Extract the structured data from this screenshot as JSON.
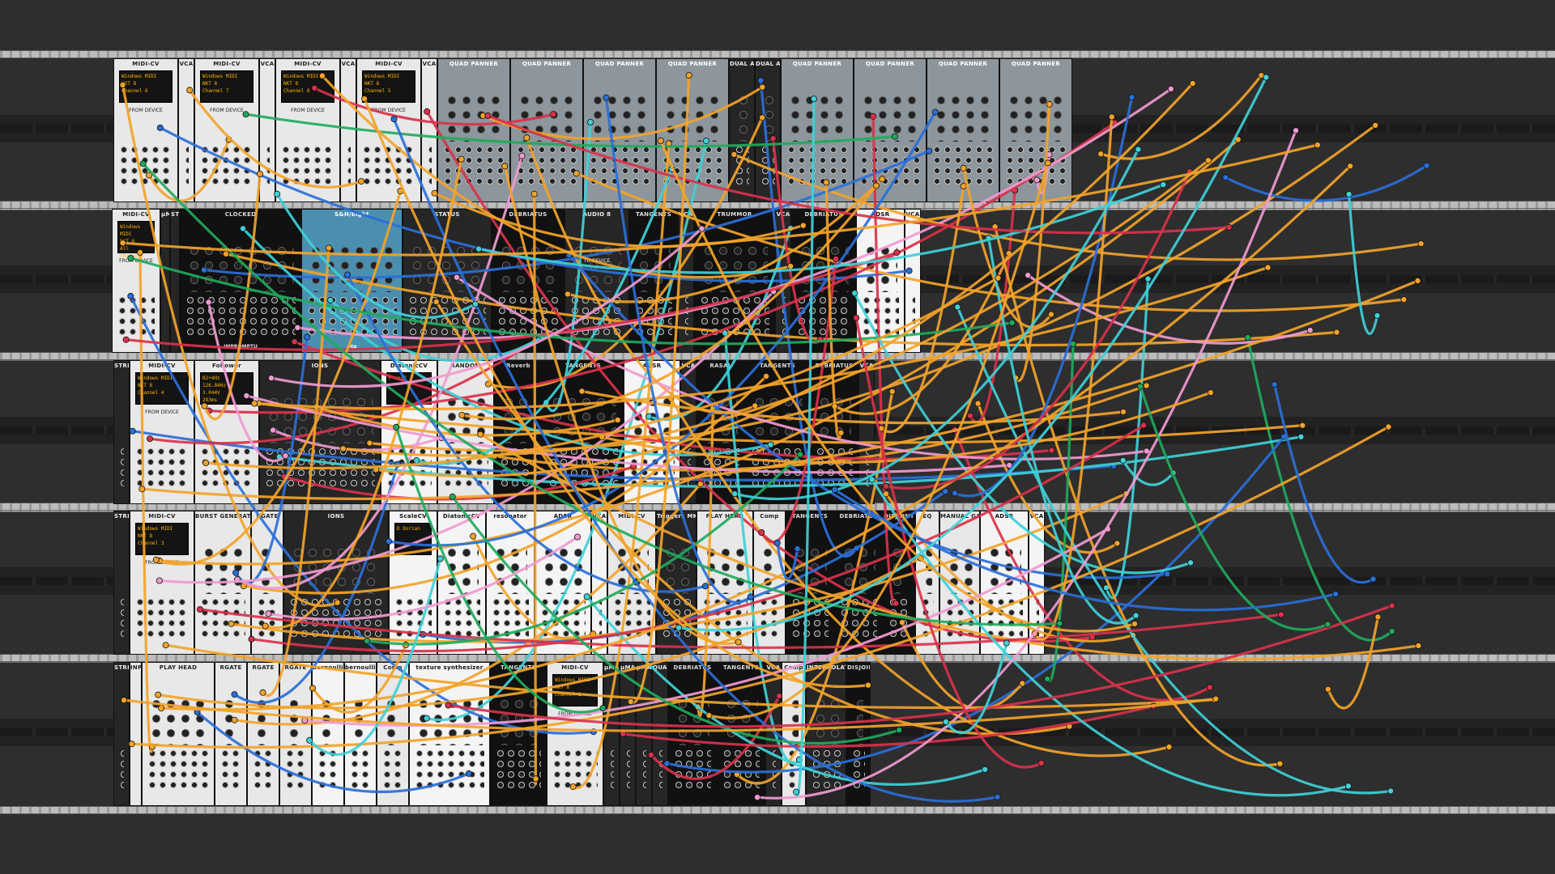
{
  "app": {
    "name": "VCV Rack patch"
  },
  "colors": {
    "orange": "#f2a32a",
    "red": "#d8324a",
    "green": "#1faa5c",
    "cyan": "#3fd0d8",
    "pink": "#f09ad0",
    "blue": "#2a6fd8"
  },
  "rows": [
    {
      "index": 0,
      "modules": [
        {
          "label": "MIDI-CV",
          "name": "midi-cv-r1a",
          "kind": "light",
          "midi": [
            "Windows MIDI",
            "NKT 8",
            "Channel 6"
          ],
          "sub": "FROM DEVICE"
        },
        {
          "label": "VCA",
          "name": "vca-r1a",
          "kind": "light"
        },
        {
          "label": "MIDI-CV",
          "name": "midi-cv-r1b",
          "kind": "light",
          "midi": [
            "Windows MIDI",
            "NKT 8",
            "Channel 7"
          ],
          "sub": "FROM DEVICE"
        },
        {
          "label": "VCA",
          "name": "vca-r1b",
          "kind": "light"
        },
        {
          "label": "MIDI-CV",
          "name": "midi-cv-r1c",
          "kind": "light",
          "midi": [
            "Windows MIDI",
            "NKT 8",
            "Channel 8"
          ],
          "sub": "FROM DEVICE"
        },
        {
          "label": "VCA",
          "name": "vca-r1c",
          "kind": "light"
        },
        {
          "label": "MIDI-CV",
          "name": "midi-cv-r1d",
          "kind": "light",
          "midi": [
            "Windows MIDI",
            "NKT 8",
            "Channel 5"
          ],
          "sub": "FROM DEVICE"
        },
        {
          "label": "VCA",
          "name": "vca-r1d",
          "kind": "light"
        },
        {
          "label": "QUAD PANNER",
          "name": "quad-panner-1",
          "kind": "grey"
        },
        {
          "label": "QUAD PANNER",
          "name": "quad-panner-2",
          "kind": "grey"
        },
        {
          "label": "QUAD PANNER",
          "name": "quad-panner-3",
          "kind": "grey"
        },
        {
          "label": "QUAD PANNER",
          "name": "quad-panner-4",
          "kind": "grey"
        },
        {
          "label": "DUAL ATTENUVERTER",
          "name": "dual-attenuverter-1",
          "kind": "dark"
        },
        {
          "label": "DUAL ATTENUVERTER",
          "name": "dual-attenuverter-2",
          "kind": "dark"
        },
        {
          "label": "QUAD PANNER",
          "name": "quad-panner-5",
          "kind": "grey"
        },
        {
          "label": "QUAD PANNER",
          "name": "quad-panner-6",
          "kind": "grey"
        },
        {
          "label": "QUAD PANNER",
          "name": "quad-panner-7",
          "kind": "grey"
        },
        {
          "label": "QUAD PANNER",
          "name": "quad-panner-8",
          "kind": "grey"
        }
      ]
    },
    {
      "index": 1,
      "modules": [
        {
          "label": "MIDI-CV",
          "name": "midi-cv-r2a",
          "kind": "light",
          "midi": [
            "Windows MIDI",
            "NKT 8",
            "All channels"
          ],
          "sub": "FROM DEVICE"
        },
        {
          "label": "μMAP",
          "name": "umap-r2",
          "kind": "dark"
        },
        {
          "label": "STRIP",
          "name": "strip-r2",
          "kind": "dark"
        },
        {
          "label": "CLOCKED",
          "name": "clocked",
          "kind": "black",
          "footer": "IMPROMPTU"
        },
        {
          "label": "S&H/Eight",
          "name": "sh-eight",
          "kind": "blue",
          "footer": "→tp"
        },
        {
          "label": "STATUS",
          "name": "status",
          "kind": "dark"
        },
        {
          "label": "DEBRIATUS",
          "name": "debriatus-r2a",
          "kind": "black"
        },
        {
          "label": "AUDIO 8",
          "name": "audio-8",
          "kind": "dark",
          "sub": "TO DEVICE"
        },
        {
          "label": "TANGENTS",
          "name": "tangents-r2",
          "kind": "black"
        },
        {
          "label": "VCA",
          "name": "vca-r2a",
          "kind": "dark"
        },
        {
          "label": "TRUMMOR",
          "name": "trummor",
          "kind": "black"
        },
        {
          "label": "VCA",
          "name": "vca-r2b",
          "kind": "dark"
        },
        {
          "label": "DEBRIATUS",
          "name": "debriatus-r2b",
          "kind": "black"
        },
        {
          "label": "ADSR",
          "name": "adsr-r2",
          "kind": "white"
        },
        {
          "label": "VCA",
          "name": "vca-r2c",
          "kind": "white"
        }
      ]
    },
    {
      "index": 2,
      "modules": [
        {
          "label": "STRIP",
          "name": "strip-r3",
          "kind": "dark"
        },
        {
          "label": "MIDI-CV",
          "name": "midi-cv-r3",
          "kind": "light",
          "midi": [
            "Windows MIDI",
            "NKT 8",
            "Channel 4"
          ],
          "sub": "FROM DEVICE"
        },
        {
          "label": "Follower",
          "name": "follower",
          "kind": "light",
          "screen": [
            "B2+4Hz",
            "126.84Hz",
            "3.044V",
            "283ms"
          ]
        },
        {
          "label": "IONS",
          "name": "ions-r3",
          "kind": "dark"
        },
        {
          "label": "DiatonicCV",
          "name": "diatonic-cv-r3",
          "kind": "white",
          "screen": [
            "F maj7"
          ]
        },
        {
          "label": "RANDOM",
          "name": "random",
          "kind": "light"
        },
        {
          "label": "Reverb",
          "name": "reverb",
          "kind": "black"
        },
        {
          "label": "TANGENTS",
          "name": "tangents-r3a",
          "kind": "black"
        },
        {
          "label": "ADSR",
          "name": "adsr-r3",
          "kind": "white"
        },
        {
          "label": "VCA",
          "name": "vca-r3a",
          "kind": "dark"
        },
        {
          "label": "RASAL",
          "name": "rasal",
          "kind": "black"
        },
        {
          "label": "TANGENTS",
          "name": "tangents-r3b",
          "kind": "black"
        },
        {
          "label": "DEBRIATUS",
          "name": "debriatus-r3",
          "kind": "black"
        },
        {
          "label": "VCA",
          "name": "vca-r3b",
          "kind": "dark"
        }
      ]
    },
    {
      "index": 3,
      "modules": [
        {
          "label": "STRIP",
          "name": "strip-r4",
          "kind": "dark"
        },
        {
          "label": "MIDI-CV",
          "name": "midi-cv-r4",
          "kind": "light",
          "midi": [
            "Windows MIDI",
            "NKT 8",
            "Channel 3"
          ],
          "sub": "FROM DEVICE"
        },
        {
          "label": "BURST GENERATOR",
          "name": "burst-generator",
          "kind": "light"
        },
        {
          "label": "RGATE",
          "name": "rgate-r4",
          "kind": "light"
        },
        {
          "label": "IONS",
          "name": "ions-r4",
          "kind": "dark"
        },
        {
          "label": "ScaleCV",
          "name": "scale-cv",
          "kind": "white",
          "screen": [
            "D Dorian"
          ]
        },
        {
          "label": "DiatonicCV",
          "name": "diatonic-cv-r4",
          "kind": "white"
        },
        {
          "label": "resonator",
          "name": "resonator",
          "kind": "white"
        },
        {
          "label": "ADSR",
          "name": "adsr-r4a",
          "kind": "white"
        },
        {
          "label": "VCA",
          "name": "vca-r4a",
          "kind": "white"
        },
        {
          "label": "MIDI-CV",
          "name": "midi-cv-r4b",
          "kind": "light"
        },
        {
          "label": "Triggers MKII",
          "name": "triggers-mkii",
          "kind": "dark"
        },
        {
          "label": "PLAY HEAD",
          "name": "play-head-r4",
          "kind": "light"
        },
        {
          "label": "Comp",
          "name": "comp-r4",
          "kind": "light"
        },
        {
          "label": "TANGENTS",
          "name": "tangents-r4",
          "kind": "black"
        },
        {
          "label": "DEBRIATUS",
          "name": "debriatus-r4",
          "kind": "black"
        },
        {
          "label": "DISJOINT",
          "name": "disjoint-r4",
          "kind": "black"
        },
        {
          "label": "EQ",
          "name": "eq-r4",
          "kind": "light"
        },
        {
          "label": "MANUAL GATE",
          "name": "manual-gate",
          "kind": "light"
        },
        {
          "label": "ADSR",
          "name": "adsr-r4b",
          "kind": "white"
        },
        {
          "label": "VCA",
          "name": "vca-r4b",
          "kind": "white"
        }
      ]
    },
    {
      "index": 4,
      "modules": [
        {
          "label": "STRIP",
          "name": "strip-r5",
          "kind": "dark"
        },
        {
          "label": "INPUT",
          "name": "input-r5",
          "kind": "light"
        },
        {
          "label": "PLAY HEAD",
          "name": "play-head-r5",
          "kind": "light"
        },
        {
          "label": "RGATE",
          "name": "rgate-r5a",
          "kind": "light"
        },
        {
          "label": "RGATE",
          "name": "rgate-r5b",
          "kind": "light"
        },
        {
          "label": "RGATE",
          "name": "rgate-r5c",
          "kind": "light"
        },
        {
          "label": "bernoulli gate",
          "name": "bernoulli-gate-1",
          "kind": "white"
        },
        {
          "label": "bernoulli gate",
          "name": "bernoulli-gate-2",
          "kind": "white"
        },
        {
          "label": "Comp",
          "name": "comp-r5",
          "kind": "light"
        },
        {
          "label": "texture synthesizer",
          "name": "texture-synth",
          "kind": "white"
        },
        {
          "label": "TANGENTS",
          "name": "tangents-r5a",
          "kind": "black"
        },
        {
          "label": "MIDI-CV",
          "name": "midi-cv-r5",
          "kind": "light",
          "midi": [
            "Windows MIDI",
            "NKT 8",
            "Channel 1"
          ],
          "sub": "FROM DEVICE"
        },
        {
          "label": "μMAP",
          "name": "umap-r5a",
          "kind": "dark"
        },
        {
          "label": "μMAP",
          "name": "umap-r5b",
          "kind": "dark"
        },
        {
          "label": "μMAP",
          "name": "umap-r5c",
          "kind": "dark"
        },
        {
          "label": "QUAD",
          "name": "quad-r5",
          "kind": "dark"
        },
        {
          "label": "DEBRIATUS",
          "name": "debriatus-r5",
          "kind": "black"
        },
        {
          "label": "TANGENTS",
          "name": "tangents-r5b",
          "kind": "black"
        },
        {
          "label": "VCA",
          "name": "vca-r5",
          "kind": "dark"
        },
        {
          "label": "Comp",
          "name": "comp-r5b",
          "kind": "light"
        },
        {
          "label": "INTERPOLATION",
          "name": "interpolation",
          "kind": "dark"
        },
        {
          "label": "DISJOINT",
          "name": "disjoint-r5",
          "kind": "black"
        }
      ]
    }
  ]
}
